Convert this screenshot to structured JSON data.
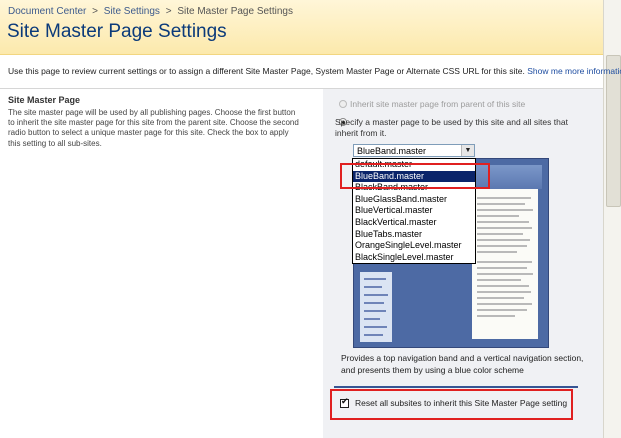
{
  "breadcrumb": {
    "items": [
      "Document Center",
      "Site Settings",
      "Site Master Page Settings"
    ],
    "separator": ">"
  },
  "page_title": "Site Master Page Settings",
  "description": {
    "text": "Use this page to review current settings or to assign a different Site Master Page, System Master Page or Alternate CSS URL for this site.",
    "link": "Show me more information."
  },
  "section": {
    "title": "Site Master Page",
    "text": "The site master page will be used by all publishing pages. Choose the first button to inherit the site master page for this site from the parent site. Choose the second radio button to select a unique master page for this site. Check the box to apply this setting to all sub-sites."
  },
  "options": {
    "inherit_label": "Inherit site master page from parent of this site",
    "specify_label": "Specify a master page to be used by this site and all sites that inherit from it."
  },
  "master_select": {
    "value": "BlueBand.master",
    "options": [
      "default.master",
      "BlueBand.master",
      "BlackBand.master",
      "BlueGlassBand.master",
      "BlueVertical.master",
      "BlackVertical.master",
      "BlueTabs.master",
      "OrangeSingleLevel.master",
      "BlackSingleLevel.master"
    ],
    "selected_index": 1
  },
  "template_description": "Provides a top navigation band and a vertical navigation section, and presents them by using a blue color scheme",
  "reset_checkbox": {
    "label": "Reset all subsites to inherit this Site Master Page setting",
    "checked": true
  },
  "colors": {
    "title": "#0b3a7a",
    "link": "#1f4ea1",
    "title_band": "#fce9ac",
    "highlight": "#e02020",
    "list_selected": "#0a246a"
  },
  "icons": {
    "select_arrow": "chevron-down-icon",
    "check": "checkmark-icon"
  }
}
